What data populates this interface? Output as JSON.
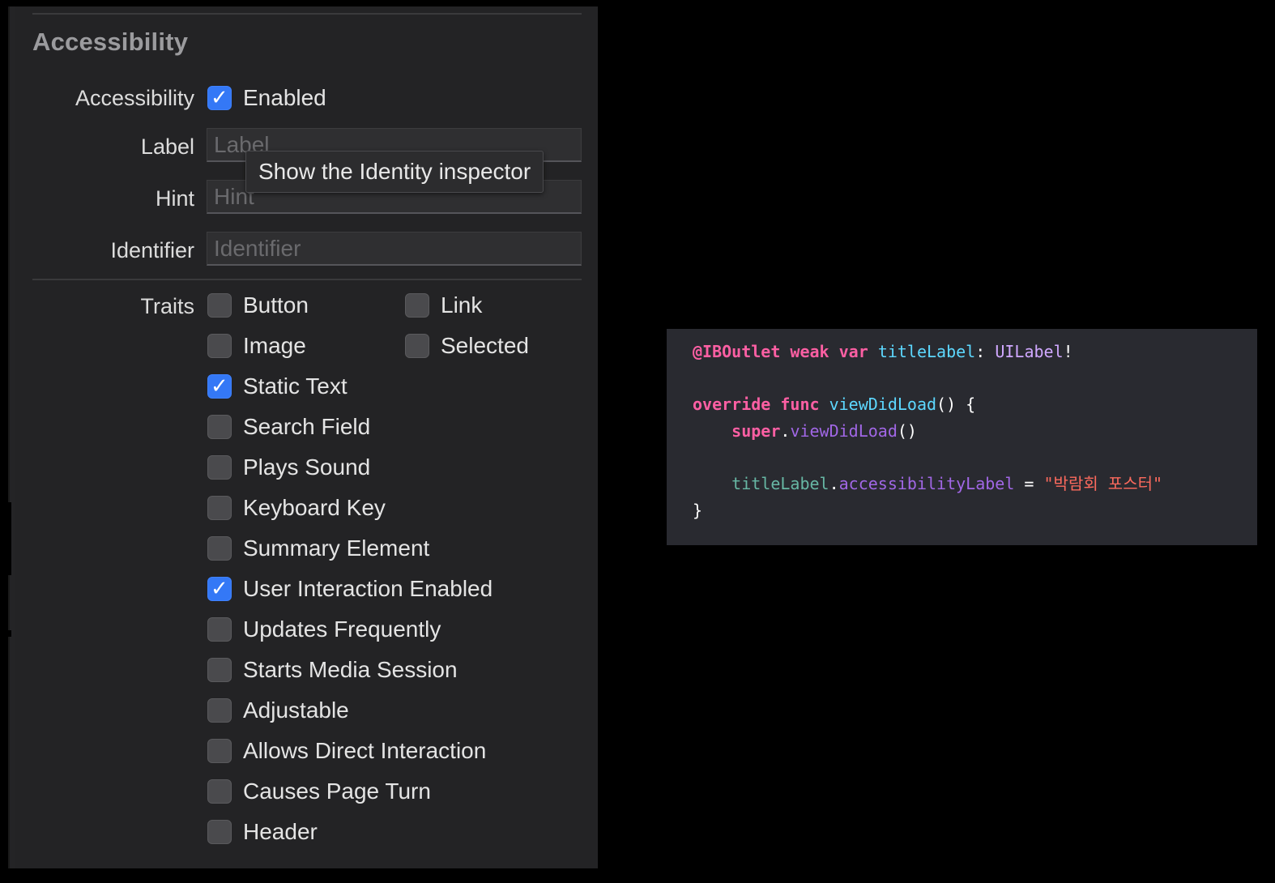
{
  "inspector": {
    "section_title": "Accessibility",
    "accessibility_row": {
      "label": "Accessibility",
      "checkbox_label": "Enabled",
      "checked": true
    },
    "fields": [
      {
        "label": "Label",
        "placeholder": "Label",
        "value": ""
      },
      {
        "label": "Hint",
        "placeholder": "Hint",
        "value": ""
      },
      {
        "label": "Identifier",
        "placeholder": "Identifier",
        "value": ""
      }
    ],
    "traits_label": "Traits",
    "traits": [
      {
        "label": "Button",
        "checked": false
      },
      {
        "label": "Link",
        "checked": false
      },
      {
        "label": "Image",
        "checked": false
      },
      {
        "label": "Selected",
        "checked": false
      },
      {
        "label": "Static Text",
        "checked": true
      },
      {
        "label": "Search Field",
        "checked": false
      },
      {
        "label": "Plays Sound",
        "checked": false
      },
      {
        "label": "Keyboard Key",
        "checked": false
      },
      {
        "label": "Summary Element",
        "checked": false
      },
      {
        "label": "User Interaction Enabled",
        "checked": true
      },
      {
        "label": "Updates Frequently",
        "checked": false
      },
      {
        "label": "Starts Media Session",
        "checked": false
      },
      {
        "label": "Adjustable",
        "checked": false
      },
      {
        "label": "Allows Direct Interaction",
        "checked": false
      },
      {
        "label": "Causes Page Turn",
        "checked": false
      },
      {
        "label": "Header",
        "checked": false
      }
    ],
    "tooltip": "Show the Identity inspector"
  },
  "code": {
    "line1": {
      "attr": "@IBOutlet",
      "kw1": "weak",
      "kw2": "var",
      "name": "titleLabel",
      "colon": ":",
      "type": "UILabel",
      "bang": "!"
    },
    "line2": {
      "kw1": "override",
      "kw2": "func",
      "name": "viewDidLoad",
      "rest": "() {"
    },
    "line3": {
      "kw": "super",
      "dot": ".",
      "method": "viewDidLoad",
      "rest": "()"
    },
    "line4": {
      "ident": "titleLabel",
      "dot": ".",
      "prop": "accessibilityLabel",
      "eq": " = ",
      "str": "\"박람회 포스터\""
    },
    "line5": "}"
  },
  "colors": {
    "checkbox_checked": "#3478f6",
    "code_background": "#292a30",
    "panel_background": "#232325"
  }
}
